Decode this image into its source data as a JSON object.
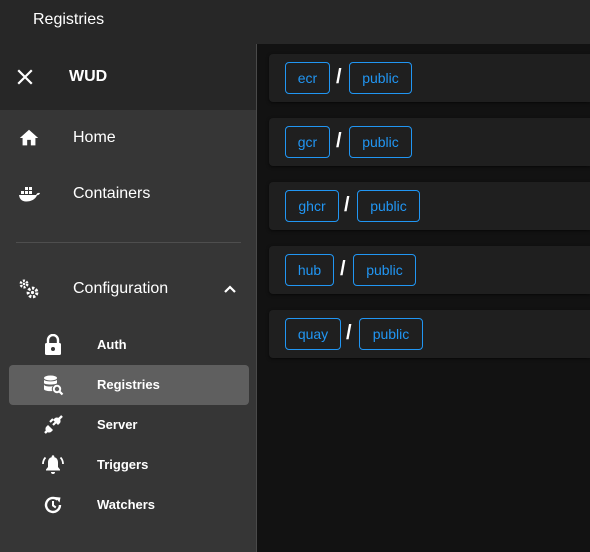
{
  "topbar": {
    "title": "Registries"
  },
  "drawer": {
    "title": "WUD",
    "nav": [
      {
        "label": "Home",
        "icon": "home-icon"
      },
      {
        "label": "Containers",
        "icon": "docker-icon"
      }
    ],
    "configuration": {
      "label": "Configuration",
      "icon": "cogs-icon",
      "expanded": true,
      "items": [
        {
          "label": "Auth",
          "icon": "lock-icon",
          "active": false
        },
        {
          "label": "Registries",
          "icon": "database-search-icon",
          "active": true
        },
        {
          "label": "Server",
          "icon": "power-plug-icon",
          "active": false
        },
        {
          "label": "Triggers",
          "icon": "bell-ring-icon",
          "active": false
        },
        {
          "label": "Watchers",
          "icon": "clock-refresh-icon",
          "active": false
        }
      ]
    }
  },
  "registries": [
    {
      "type": "ecr",
      "name": "public"
    },
    {
      "type": "gcr",
      "name": "public"
    },
    {
      "type": "ghcr",
      "name": "public"
    },
    {
      "type": "hub",
      "name": "public"
    },
    {
      "type": "quay",
      "name": "public"
    }
  ],
  "separator": "/",
  "colors": {
    "accent": "#2196f3",
    "appbar": "#272727",
    "drawer": "#363636",
    "background": "#121212",
    "card": "#1f1f1f",
    "active_item": "#5f5f5f"
  }
}
